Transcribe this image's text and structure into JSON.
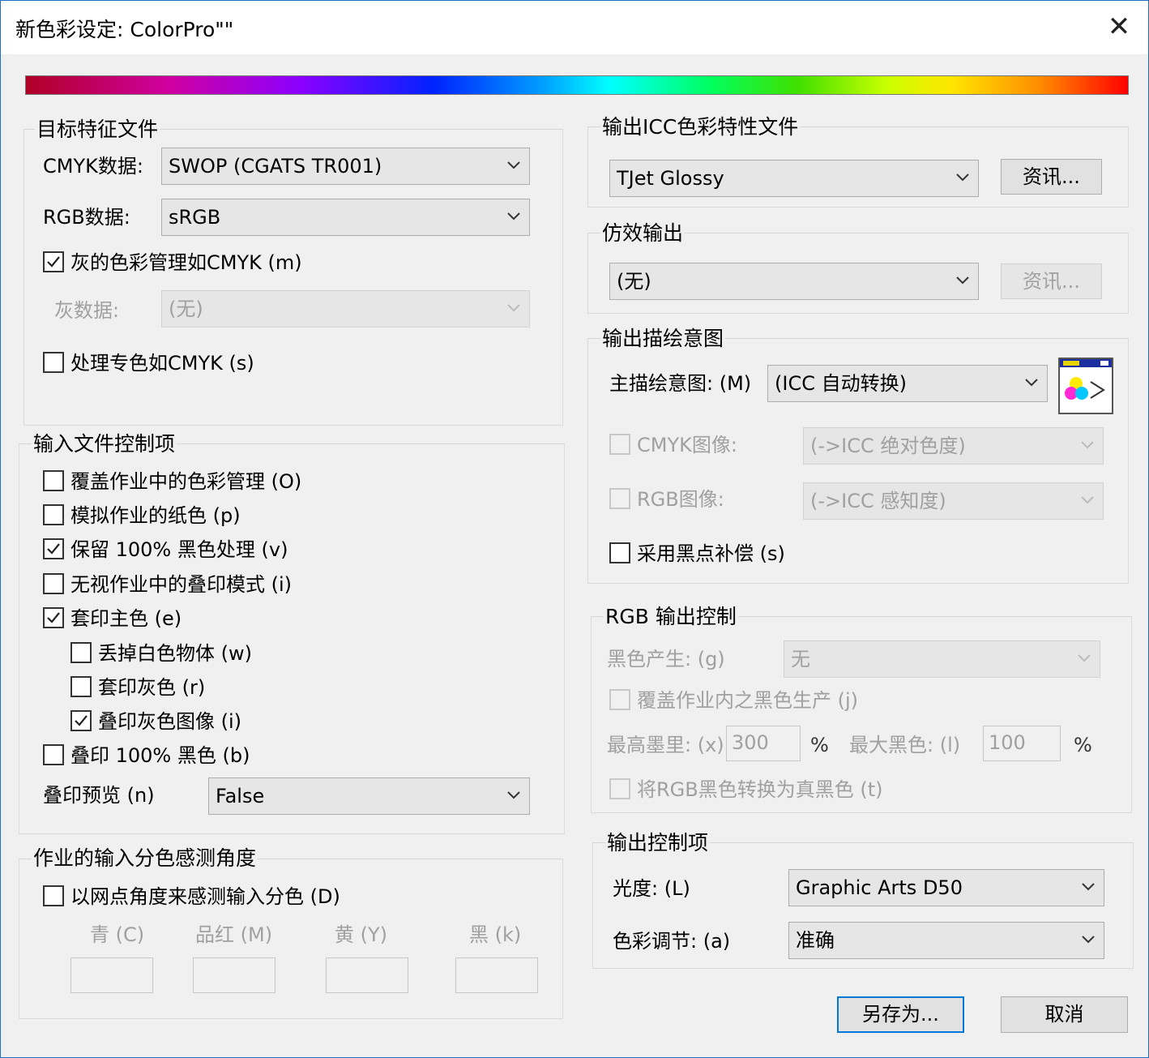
{
  "window": {
    "title": "新色彩设定: ColorPro\"\""
  },
  "target_profiles": {
    "title": "目标特征文件",
    "cmyk_label": "CMYK数据:",
    "cmyk_value": "SWOP (CGATS TR001)",
    "rgb_label": "RGB数据:",
    "rgb_value": "sRGB",
    "gray_cmyk_label": "灰的色彩管理如CMYK (m)",
    "gray_cmyk_checked": true,
    "gray_data_label": "灰数据:",
    "gray_data_value": "(无)",
    "spot_cmyk_label": "处理专色如CMYK (s)",
    "spot_cmyk_checked": false
  },
  "input_controls": {
    "title": "输入文件控制项",
    "items": [
      {
        "label": "覆盖作业中的色彩管理 (O)",
        "checked": false
      },
      {
        "label": "模拟作业的纸色 (p)",
        "checked": false
      },
      {
        "label": "保留 100% 黑色处理 (v)",
        "checked": true
      },
      {
        "label": "无视作业中的叠印模式 (i)",
        "checked": false
      },
      {
        "label": "套印主色 (e)",
        "checked": true
      },
      {
        "label": "丢掉白色物体 (w)",
        "checked": false
      },
      {
        "label": "套印灰色 (r)",
        "checked": false
      },
      {
        "label": "叠印灰色图像 (i)",
        "checked": true
      },
      {
        "label": "叠印 100% 黑色 (b)",
        "checked": false
      }
    ],
    "preview_label": "叠印预览 (n)",
    "preview_value": "False"
  },
  "separation_angle": {
    "title": "作业的输入分色感测角度",
    "detect_label": "以网点角度来感测输入分色 (D)",
    "detect_checked": false,
    "cyan": "青 (C)",
    "magenta": "品红 (M)",
    "yellow": "黄 (Y)",
    "black": "黑 (k)"
  },
  "output_icc": {
    "title": "输出ICC色彩特性文件",
    "value": "TJet Glossy",
    "info_button": "资讯..."
  },
  "emulation": {
    "title": "仿效输出",
    "value": "(无)",
    "info_button": "资讯..."
  },
  "rendering_intent": {
    "title": "输出描绘意图",
    "main_label": "主描绘意图: (M)",
    "main_value": "(ICC 自动转换)",
    "cmyk_label": "CMYK图像:",
    "cmyk_value": "(->ICC 绝对色度)",
    "rgb_label": "RGB图像:",
    "rgb_value": "(->ICC 感知度)",
    "bpc_label": "采用黑点补偿 (s)",
    "bpc_checked": false
  },
  "rgb_output": {
    "title": "RGB 输出控制",
    "black_gen_label": "黑色产生: (g)",
    "black_gen_value": "无",
    "override_label": "覆盖作业内之黑色生产 (j)",
    "max_ink_label": "最高墨里: (x)",
    "max_ink_value": "300",
    "max_black_label": "最大黑色: (l)",
    "max_black_value": "100",
    "percent": "%",
    "convert_label": "将RGB黑色转换为真黑色 (t)"
  },
  "output_controls": {
    "title": "输出控制项",
    "illum_label": "光度: (L)",
    "illum_value": "Graphic Arts D50",
    "color_adj_label": "色彩调节: (a)",
    "color_adj_value": "准确"
  },
  "buttons": {
    "save_as": "另存为...",
    "cancel": "取消"
  },
  "icons": {
    "close": "close-icon",
    "dropdown": "chevron-down-icon",
    "check": "checkmark-icon",
    "intent": "color-preview-icon"
  }
}
